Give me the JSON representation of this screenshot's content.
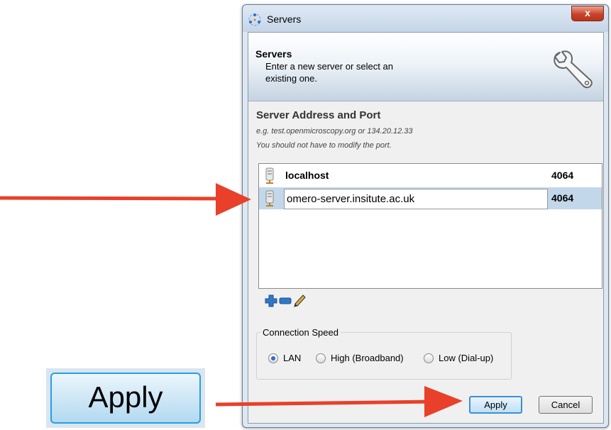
{
  "window": {
    "title": "Servers",
    "close_label": "x"
  },
  "banner": {
    "title": "Servers",
    "description": "Enter a new server or select an existing one."
  },
  "server_section": {
    "title": "Server Address and Port",
    "hint_example": "e.g. test.openmicroscopy.org or 134.20.12.33",
    "hint_port": "You should not have to modify the port."
  },
  "servers": [
    {
      "name": "localhost",
      "port": "4064"
    },
    {
      "name": "omero-server.insitute.ac.uk",
      "port": "4064",
      "selected": true,
      "editing": true
    }
  ],
  "toolbar": {
    "add_icon": "plus-icon",
    "remove_icon": "minus-icon",
    "edit_icon": "pencil-icon"
  },
  "connection_speed": {
    "label": "Connection Speed",
    "options": [
      "LAN",
      "High (Broadband)",
      "Low (Dial-up)"
    ],
    "selected": "LAN"
  },
  "buttons": {
    "apply": "Apply",
    "cancel": "Cancel"
  },
  "callout": {
    "zoomed_apply": "Apply"
  },
  "colors": {
    "arrow": "#e8402a",
    "selection": "#c2d7ea",
    "apply_border": "#3c8fd6"
  }
}
